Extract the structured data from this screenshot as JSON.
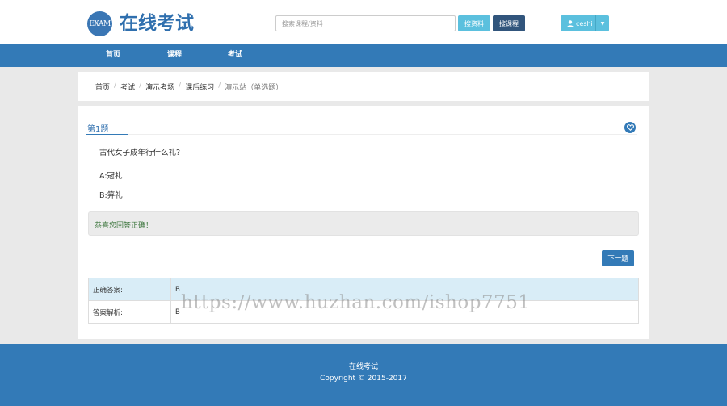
{
  "header": {
    "logo_text": "EXAM",
    "site_title": "在线考试",
    "search_placeholder": "搜索课程/资料",
    "search_material_label": "搜资料",
    "search_course_label": "搜课程",
    "user_name": "ceshi"
  },
  "nav": {
    "items": [
      {
        "label": "首页"
      },
      {
        "label": "课程"
      },
      {
        "label": "考试"
      }
    ]
  },
  "breadcrumb": {
    "items": [
      "首页",
      "考试",
      "演示考场",
      "课后练习",
      "演示站（单选题）"
    ]
  },
  "question": {
    "number_label": "第1题",
    "text": "古代女子成年行什么礼?",
    "options": [
      "A:冠礼",
      "B:笄礼"
    ],
    "result_message": "恭喜您回答正确！",
    "next_label": "下一题"
  },
  "answer_table": {
    "rows": [
      {
        "label": "正确答案:",
        "value": "B"
      },
      {
        "label": "答案解析:",
        "value": "B"
      }
    ]
  },
  "watermark": "https://www.huzhan.com/ishop7751",
  "footer": {
    "title": "在线考试",
    "copyright": "Copyright © 2015-2017"
  },
  "colors": {
    "primary": "#337ab7",
    "info": "#5bc0de",
    "success_text": "#3c763d"
  }
}
